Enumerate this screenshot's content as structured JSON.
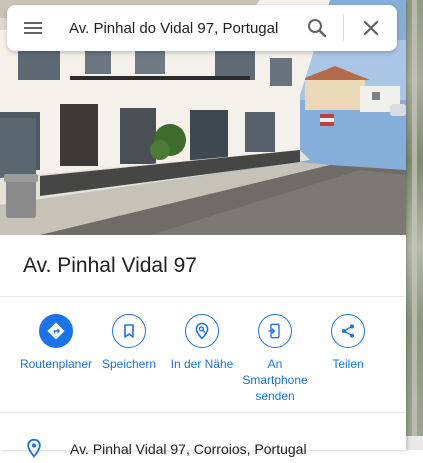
{
  "search": {
    "value": "Av. Pinhal do Vidal 97, Portugal",
    "menu_icon": "menu-icon",
    "search_icon": "search-icon",
    "close_icon": "close-icon"
  },
  "place": {
    "title": "Av. Pinhal Vidal 97",
    "address": "Av. Pinhal Vidal 97, Corroios, Portugal"
  },
  "actions": [
    {
      "label": "Routenplaner",
      "icon": "directions-icon"
    },
    {
      "label": "Speichern",
      "icon": "bookmark-icon"
    },
    {
      "label": "In der Nähe",
      "icon": "nearby-icon"
    },
    {
      "label": "An Smartphone senden",
      "icon": "send-to-phone-icon"
    },
    {
      "label": "Teilen",
      "icon": "share-icon"
    }
  ],
  "colors": {
    "accent": "#1a73e8",
    "text": "#202124",
    "icon_gray": "#5f6368"
  }
}
